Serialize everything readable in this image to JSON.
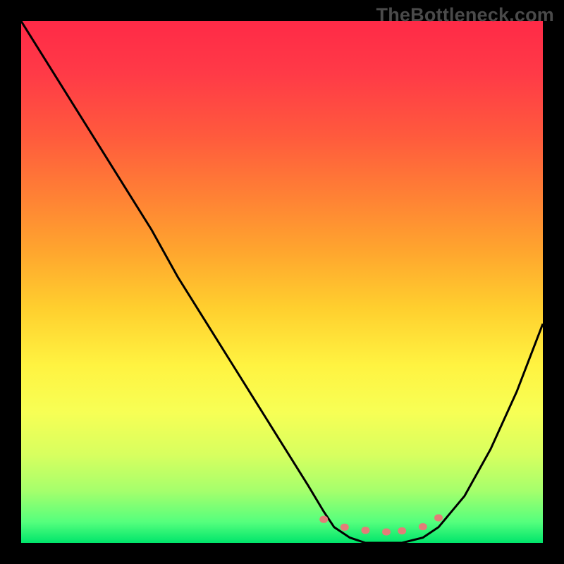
{
  "watermark": "TheBottleneck.com",
  "chart_data": {
    "type": "line",
    "title": "",
    "xlabel": "",
    "ylabel": "",
    "xlim": [
      0,
      100
    ],
    "ylim": [
      0,
      100
    ],
    "series": [
      {
        "name": "bottleneck-curve",
        "x": [
          0,
          5,
          10,
          15,
          20,
          25,
          30,
          35,
          40,
          45,
          50,
          55,
          58,
          60,
          63,
          66,
          70,
          73,
          77,
          80,
          85,
          90,
          95,
          100
        ],
        "y": [
          100,
          92,
          84,
          76,
          68,
          60,
          51,
          43,
          35,
          27,
          19,
          11,
          6,
          3,
          1,
          0,
          0,
          0,
          1,
          3,
          9,
          18,
          29,
          42
        ]
      },
      {
        "name": "valley-marker",
        "x": [
          58,
          62,
          66,
          70,
          73,
          77,
          80
        ],
        "y": [
          4.5,
          3.0,
          2.4,
          2.1,
          2.3,
          3.1,
          4.8
        ]
      }
    ],
    "annotations": []
  },
  "colors": {
    "curve": "#000000",
    "marker": "#e37d78",
    "background_top": "#ff2a47",
    "background_bottom": "#00e56b",
    "frame": "#000000"
  }
}
